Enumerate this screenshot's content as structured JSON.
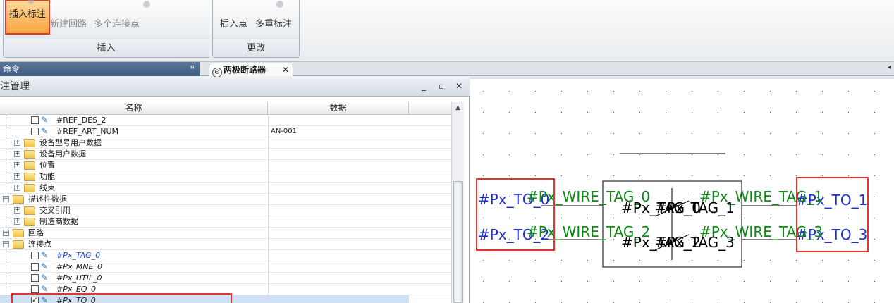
{
  "ribbon": {
    "insert_group": {
      "caption": "插入",
      "buttons": [
        "插入标注",
        "新建回路",
        "多个连接点"
      ]
    },
    "modify_group": {
      "caption": "更改",
      "buttons": [
        "插入点",
        "多重标注"
      ]
    }
  },
  "tabs": {
    "command_panel": "命令",
    "pin_icon": "ꟸ",
    "document": "两极断路器",
    "close": "✕",
    "scroll_arrow": "◂"
  },
  "panel": {
    "title": "标注管理",
    "buttons": {
      "minimize": "_",
      "restore": "▫",
      "close": "✕"
    },
    "columns": {
      "name": "名称",
      "data": "数据"
    },
    "rows": [
      {
        "label": "#REF_DES_2",
        "value": "",
        "kind": "check",
        "indent": 2,
        "checked": false
      },
      {
        "label": "#REF_ART_NUM",
        "value": "AN-001",
        "kind": "check",
        "indent": 2,
        "checked": false
      },
      {
        "label": "设备型号用户数据",
        "value": "",
        "kind": "folder",
        "indent": 1
      },
      {
        "label": "设备用户数据",
        "value": "",
        "kind": "folder",
        "indent": 1
      },
      {
        "label": "位置",
        "value": "",
        "kind": "folder",
        "indent": 1
      },
      {
        "label": "功能",
        "value": "",
        "kind": "folder",
        "indent": 1
      },
      {
        "label": "线束",
        "value": "",
        "kind": "folder",
        "indent": 1
      },
      {
        "label": "描述性数据",
        "value": "",
        "kind": "folder-open",
        "indent": 0
      },
      {
        "label": "交叉引用",
        "value": "",
        "kind": "folder",
        "indent": 1
      },
      {
        "label": "制造商数据",
        "value": "",
        "kind": "folder",
        "indent": 1
      },
      {
        "label": "回路",
        "value": "",
        "kind": "folder",
        "indent": 0
      },
      {
        "label": "连接点",
        "value": "",
        "kind": "folder-open",
        "indent": 0
      },
      {
        "label": "#Px_TAG_0",
        "value": "",
        "kind": "check",
        "indent": 2,
        "checked": false,
        "style": "blue"
      },
      {
        "label": "#Px_MNE_0",
        "value": "",
        "kind": "check",
        "indent": 2,
        "checked": false,
        "style": "italic"
      },
      {
        "label": "#Px_UTIL_0",
        "value": "",
        "kind": "check",
        "indent": 2,
        "checked": false,
        "style": "italic"
      },
      {
        "label": "#Px_EQ_0",
        "value": "",
        "kind": "check",
        "indent": 2,
        "checked": false,
        "style": "italic"
      },
      {
        "label": "#Px_TO_0",
        "value": "",
        "kind": "check",
        "indent": 2,
        "checked": true,
        "selected": true,
        "style": "italic"
      }
    ],
    "glyphs": {
      "plus": "+",
      "minus": "−",
      "check": "✓",
      "pen": "✎",
      "scroll_up": "▲"
    }
  },
  "canvas": {
    "left_terminals": [
      "#Px_TO_0",
      "#Px_TO_2"
    ],
    "right_terminals": [
      "#Px_TO_1",
      "#Px_TO_3"
    ],
    "wire_tags": [
      "#Px_WIRE_TAG_0",
      "#Px_WIRE_TAG_1",
      "#Px_WIRE_TAG_2",
      "#Px_WIRE_TAG_3"
    ],
    "device_tags": [
      "#Px_TAG_0",
      "#Px_TAG_1",
      "#Px_TAG_2",
      "#Px_TAG_3"
    ]
  },
  "colors": {
    "highlight": "#e8322c",
    "active_button": "#f7a53f",
    "terminal_text": "#1d2fd0",
    "wire_text": "#0f8a17"
  }
}
